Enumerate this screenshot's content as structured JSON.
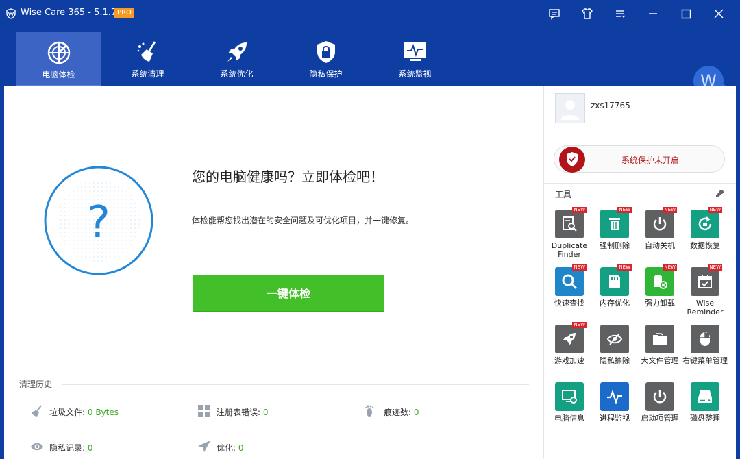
{
  "titlebar": {
    "title": "Wise Care 365 - 5.1.7",
    "badge": "PRO"
  },
  "nav": {
    "items": [
      {
        "label": "电脑体检",
        "icon": "radar-icon",
        "active": true
      },
      {
        "label": "系统清理",
        "icon": "broom-icon",
        "active": false
      },
      {
        "label": "系统优化",
        "icon": "rocket-icon",
        "active": false
      },
      {
        "label": "隐私保护",
        "icon": "lock-shield-icon",
        "active": false
      },
      {
        "label": "系统监视",
        "icon": "monitor-pulse-icon",
        "active": false
      }
    ],
    "avatar_letter": "W"
  },
  "main": {
    "health_title": "您的电脑健康吗？立即体检吧！",
    "health_desc": "体检能帮您找出潜在的安全问题及可优化项目，并一键修复。",
    "check_button": "一键体检",
    "history_title": "清理历史",
    "stats": {
      "junk": {
        "label": "垃圾文件:",
        "value": "0 Bytes"
      },
      "registry": {
        "label": "注册表错误:",
        "value": "0"
      },
      "traces": {
        "label": "痕迹数:",
        "value": "0"
      },
      "privacy": {
        "label": "隐私记录:",
        "value": "0"
      },
      "optimize": {
        "label": "优化:",
        "value": "0"
      }
    }
  },
  "right": {
    "username": "zxs17765",
    "protect_label": "系统保护未开启",
    "tools_title": "工具",
    "tools": [
      {
        "label": "Duplicate Finder",
        "new": "NEW"
      },
      {
        "label": "强制删除",
        "new": "NEW"
      },
      {
        "label": "自动关机",
        "new": "NEW"
      },
      {
        "label": "数据恢复",
        "new": "NEW"
      },
      {
        "label": "快速查找",
        "new": "NEW"
      },
      {
        "label": "内存优化",
        "new": "NEW"
      },
      {
        "label": "强力卸载",
        "new": "NEW"
      },
      {
        "label": "Wise Reminder",
        "new": "NEW"
      },
      {
        "label": "游戏加速",
        "new": "NEW"
      },
      {
        "label": "隐私擦除",
        "new": ""
      },
      {
        "label": "大文件管理",
        "new": ""
      },
      {
        "label": "右键菜单管理",
        "new": ""
      },
      {
        "label": "电脑信息",
        "new": ""
      },
      {
        "label": "进程监视",
        "new": ""
      },
      {
        "label": "启动项管理",
        "new": ""
      },
      {
        "label": "磁盘整理",
        "new": ""
      }
    ]
  },
  "colors": {
    "header": "#0f3ea3",
    "nav_active": "#3b64c5",
    "check_button": "#43bf2a",
    "protect_red": "#b1151b"
  }
}
